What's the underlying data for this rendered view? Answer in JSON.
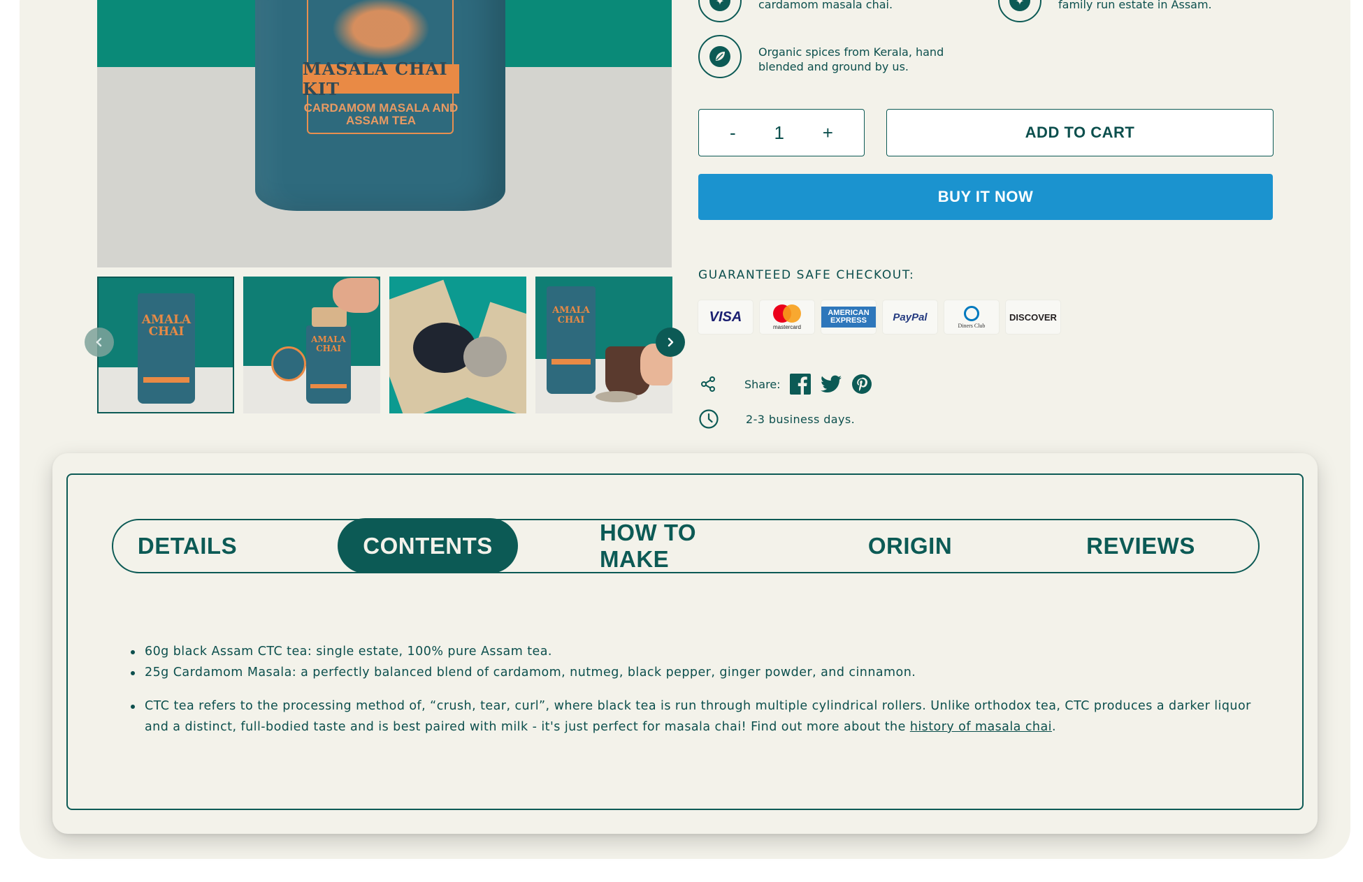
{
  "product_image": {
    "canister_title": "MASALA CHAI KIT",
    "canister_subtitle": "CARDAMOM MASALA AND ASSAM TEA"
  },
  "thumbnails": {
    "items": [
      {
        "label": "AMALA CHAI"
      },
      {
        "label": "AMALA CHAI"
      },
      {
        "label": ""
      },
      {
        "label": "AMALA CHAI"
      }
    ]
  },
  "features": {
    "row1_left_text": "cardamom masala chai.",
    "row1_right_text": "family run estate in Assam.",
    "organic_text": "Organic spices from Kerala, hand blended and ground by us."
  },
  "purchase": {
    "minus": "-",
    "quantity": "1",
    "plus": "+",
    "add_to_cart": "ADD TO CART",
    "buy_now": "BUY IT NOW"
  },
  "checkout": {
    "label": "GUARANTEED SAFE CHECKOUT:",
    "payment_methods": [
      "VISA",
      "mastercard",
      "AMERICAN EXPRESS",
      "PayPal",
      "Diners Club",
      "DISCOVER"
    ]
  },
  "share": {
    "label": "Share:",
    "networks": [
      "facebook",
      "twitter",
      "pinterest"
    ]
  },
  "delivery": {
    "text": "2-3 business days."
  },
  "tabs": {
    "items": [
      {
        "label": "DETAILS"
      },
      {
        "label": "CONTENTS"
      },
      {
        "label": "HOW TO MAKE"
      },
      {
        "label": "ORIGIN"
      },
      {
        "label": "REVIEWS"
      }
    ],
    "active_index": 1
  },
  "contents": {
    "item1": "60g black Assam CTC tea: single estate, 100% pure Assam tea.",
    "item2": "25g Cardamom Masala: a perfectly balanced blend of cardamom, nutmeg, black pepper, ginger powder, and cinnamon.",
    "item3_text": "CTC tea refers to the processing method of, “crush, tear, curl”, where black tea is run through multiple cylindrical rollers. Unlike orthodox tea, CTC produces a darker liquor and a distinct, full-bodied taste and is best paired with milk - it's just perfect for masala chai! Find out more about the ",
    "item3_link": "history of masala chai",
    "item3_end": "."
  },
  "colors": {
    "brand_teal": "#0c5a55",
    "background": "#f3f2ea",
    "buy_now_blue": "#1b93cf"
  }
}
